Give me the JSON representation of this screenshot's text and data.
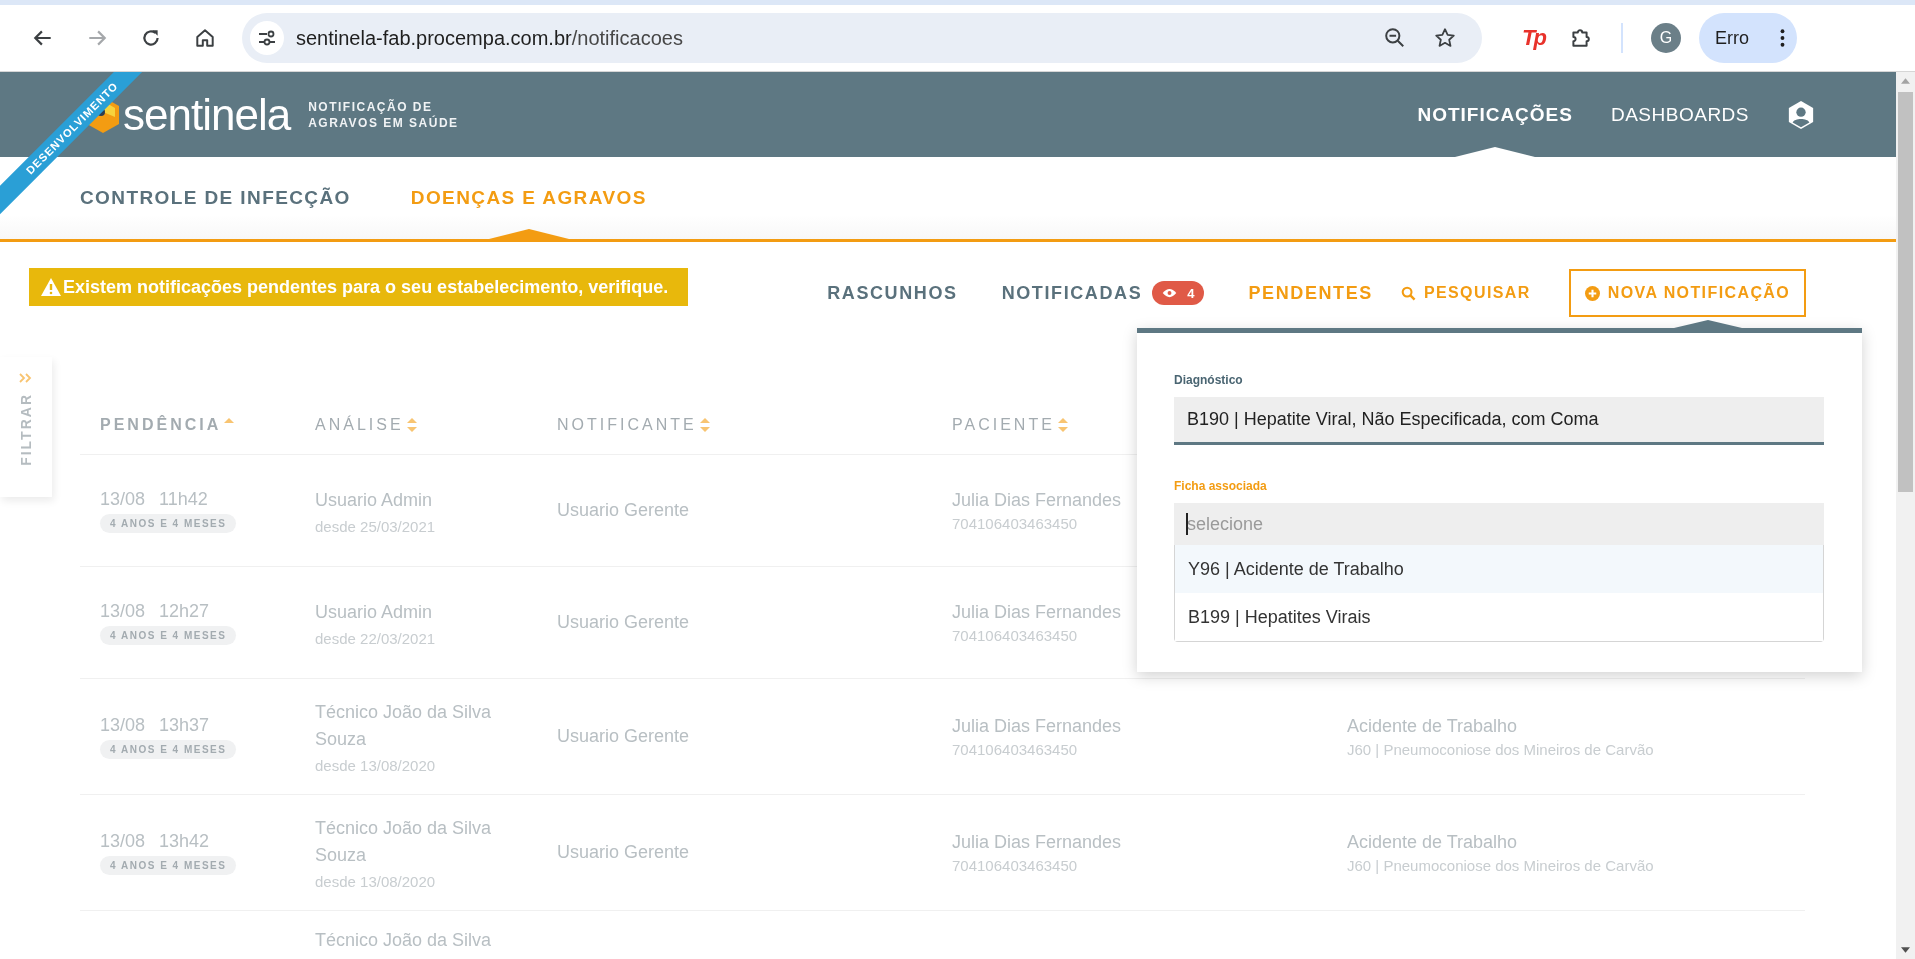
{
  "browser": {
    "url_host": "sentinela-fab.procempa.com.br",
    "url_path": "/notificacoes",
    "forward_disabled": true,
    "extension_label": "Tp",
    "avatar": "G",
    "profile_button": "Erro"
  },
  "header": {
    "ribbon": "DESENVOLVIMENTO",
    "logo": "sentinela",
    "tagline": [
      "NOTIFICAÇÃO DE",
      "AGRAVOS EM SAÚDE"
    ],
    "nav": [
      {
        "label": "NOTIFICAÇÕES",
        "selected": true
      },
      {
        "label": "DASHBOARDS",
        "selected": false
      }
    ]
  },
  "tabs": [
    {
      "label": "CONTROLE DE INFECÇÃO",
      "selected": false
    },
    {
      "label": "DOENÇAS E AGRAVOS",
      "selected": true
    }
  ],
  "alert": "Existem notificações pendentes para o seu estabelecimento, verifique.",
  "filters": [
    {
      "kind": "tab",
      "label": "RASCUNHOS",
      "selected": false
    },
    {
      "kind": "tab",
      "label": "NOTIFICADAS",
      "selected": false,
      "badge": "4"
    },
    {
      "kind": "tab",
      "label": "PENDENTES",
      "selected": true
    },
    {
      "kind": "search",
      "label": "PESQUISAR"
    },
    {
      "kind": "button",
      "label": "NOVA NOTIFICAÇÃO"
    }
  ],
  "filter_panel": {
    "label": "FILTRAR"
  },
  "table": {
    "columns": [
      {
        "label": "PENDÊNCIA",
        "sorted": true
      },
      {
        "label": "ANÁLISE",
        "sorted": false
      },
      {
        "label": "NOTIFICANTE",
        "sorted": false
      },
      {
        "label": "PACIENTE",
        "sorted": false
      }
    ],
    "rows": [
      {
        "date": "13/08",
        "time": "11h42",
        "age": "4 ANOS E 4 MESES",
        "analyst": "Usuario Admin",
        "since": "desde 25/03/2021",
        "notifier": "Usuario Gerente",
        "patient": "Julia Dias Fernandes",
        "patient_id": "704106403463450"
      },
      {
        "date": "13/08",
        "time": "12h27",
        "age": "4 ANOS E 4 MESES",
        "analyst": "Usuario Admin",
        "since": "desde 22/03/2021",
        "notifier": "Usuario Gerente",
        "patient": "Julia Dias Fernandes",
        "patient_id": "704106403463450"
      },
      {
        "date": "13/08",
        "time": "13h37",
        "age": "4 ANOS E 4 MESES",
        "analyst": "Técnico João da Silva Souza",
        "since": "desde 13/08/2020",
        "notifier": "Usuario Gerente",
        "patient": "Julia Dias Fernandes",
        "patient_id": "704106403463450",
        "disease": "Acidente de Trabalho",
        "diagnosis": "J60 | Pneumoconiose dos Mineiros de Carvão"
      },
      {
        "date": "13/08",
        "time": "13h42",
        "age": "4 ANOS E 4 MESES",
        "analyst": "Técnico João da Silva Souza",
        "since": "desde 13/08/2020",
        "notifier": "Usuario Gerente",
        "patient": "Julia Dias Fernandes",
        "patient_id": "704106403463450",
        "disease": "Acidente de Trabalho",
        "diagnosis": "J60 | Pneumoconiose dos Mineiros de Carvão"
      },
      {
        "analyst": "Técnico João da Silva"
      }
    ]
  },
  "popup": {
    "diagnosis": {
      "label": "Diagnóstico",
      "value": "B190 | Hepatite Viral, Não Especificada, com Coma"
    },
    "form": {
      "label": "Ficha associada",
      "placeholder": "selecione",
      "focused": true
    },
    "options": [
      {
        "label": "Y96 | Acidente de Trabalho",
        "selected": true
      },
      {
        "label": "B199 | Hepatites Virais",
        "selected": false
      }
    ]
  }
}
